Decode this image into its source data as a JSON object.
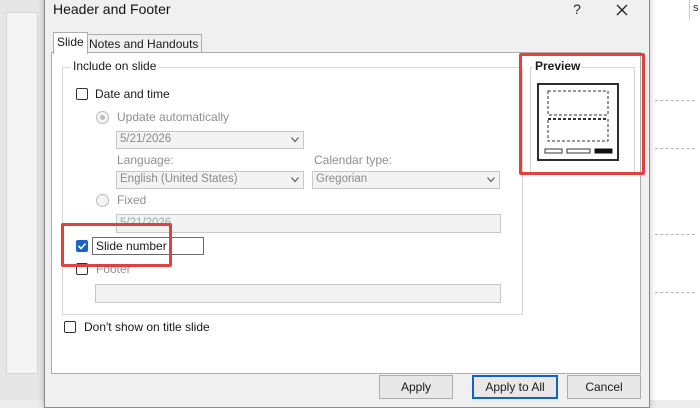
{
  "dialog": {
    "title": "Header and Footer",
    "help_glyph": "?",
    "close_icon": "close-icon",
    "tabs": [
      {
        "label": "Slide",
        "active": true
      },
      {
        "label": "Notes and Handouts",
        "active": false
      }
    ]
  },
  "include": {
    "legend": "Include on slide",
    "date_time": {
      "label": "Date and time",
      "checked": false
    },
    "update_auto": {
      "label": "Update automatically",
      "selected": true,
      "date_value": "5/21/2026"
    },
    "language": {
      "label": "Language:",
      "value": "English (United States)"
    },
    "calendar": {
      "label": "Calendar type:",
      "value": "Gregorian"
    },
    "fixed": {
      "label": "Fixed",
      "selected": false,
      "value": "5/21/2026"
    },
    "slide_number": {
      "label": "Slide number",
      "checked": true
    },
    "footer": {
      "label": "Footer",
      "checked": false,
      "value": ""
    }
  },
  "dont_show": {
    "label": "Don't show on title slide",
    "checked": false
  },
  "preview": {
    "label": "Preview"
  },
  "buttons": {
    "apply": "Apply",
    "apply_all": "Apply to All",
    "cancel": "Cancel"
  },
  "background": {
    "right_letter": "s"
  },
  "colors": {
    "highlight": "#e0413e",
    "checkbox_accent": "#1a64c8",
    "default_button_border": "#0a64d0"
  }
}
